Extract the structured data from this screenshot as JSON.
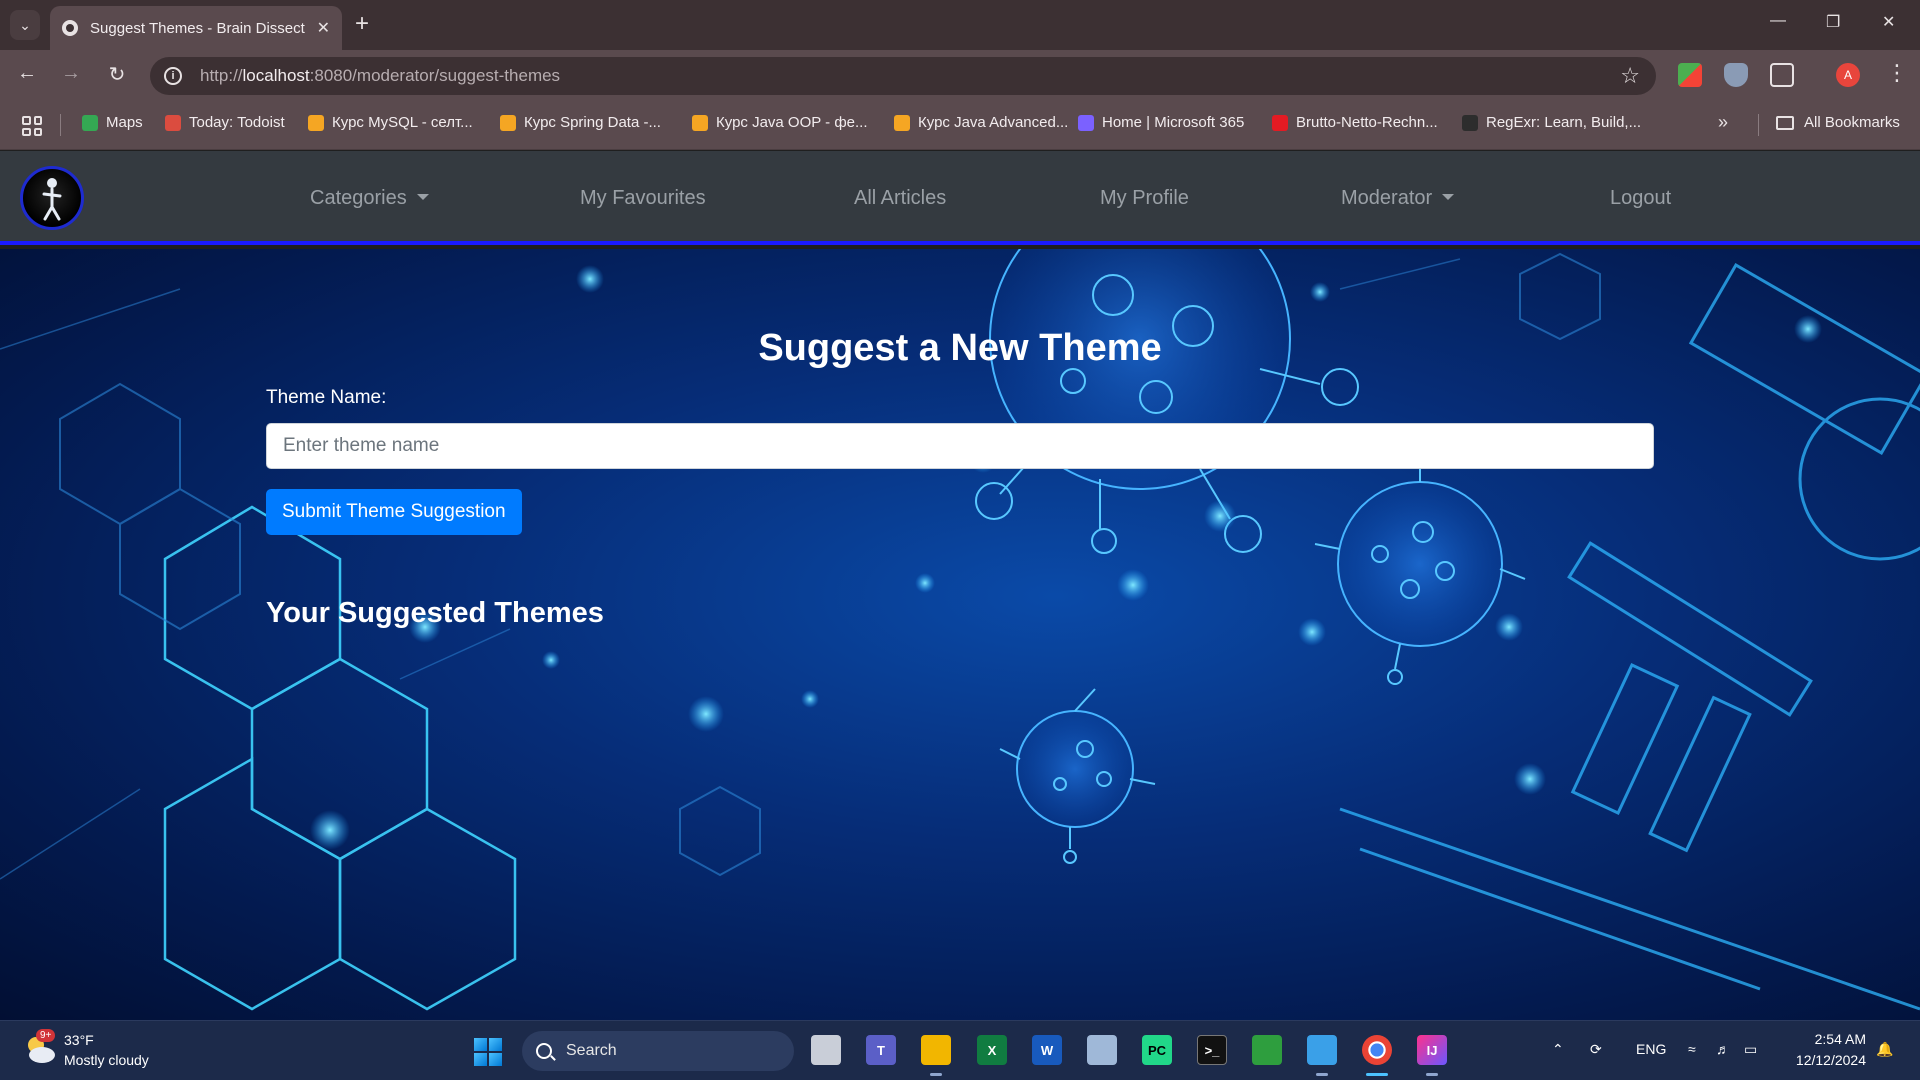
{
  "browser": {
    "tab_title": "Suggest Themes - Brain Dissect",
    "url_prefix": "http://",
    "url_host": "localhost",
    "url_rest": ":8080/moderator/suggest-themes",
    "bookmarks": [
      {
        "label": "Maps",
        "color": "#34a853"
      },
      {
        "label": "Today: Todoist",
        "color": "#db4c3f"
      },
      {
        "label": "Курс MySQL - селт...",
        "color": "#f5a623"
      },
      {
        "label": "Курс Spring Data -...",
        "color": "#f5a623"
      },
      {
        "label": "Курс Java OOP - фе...",
        "color": "#f5a623"
      },
      {
        "label": "Курс Java Advanced...",
        "color": "#f5a623"
      },
      {
        "label": "Home | Microsoft 365",
        "color": "#7b61ff"
      },
      {
        "label": "Brutto-Netto-Rechn...",
        "color": "#e31b23"
      },
      {
        "label": "RegExr: Learn, Build,...",
        "color": "#2d2d2d"
      }
    ],
    "all_bookmarks": "All Bookmarks",
    "profile_initial": "A"
  },
  "site": {
    "nav": {
      "categories": "Categories",
      "favourites": "My Favourites",
      "articles": "All Articles",
      "profile": "My Profile",
      "moderator": "Moderator",
      "logout": "Logout"
    },
    "title": "Suggest a New Theme",
    "field_label": "Theme Name:",
    "input_placeholder": "Enter theme name",
    "submit_label": "Submit Theme Suggestion",
    "suggested_title": "Your Suggested Themes"
  },
  "taskbar": {
    "weather_badge": "9+",
    "weather_temp": "33°F",
    "weather_desc": "Mostly cloudy",
    "search_label": "Search",
    "lang": "ENG",
    "time": "2:54 AM",
    "date": "12/12/2024"
  }
}
